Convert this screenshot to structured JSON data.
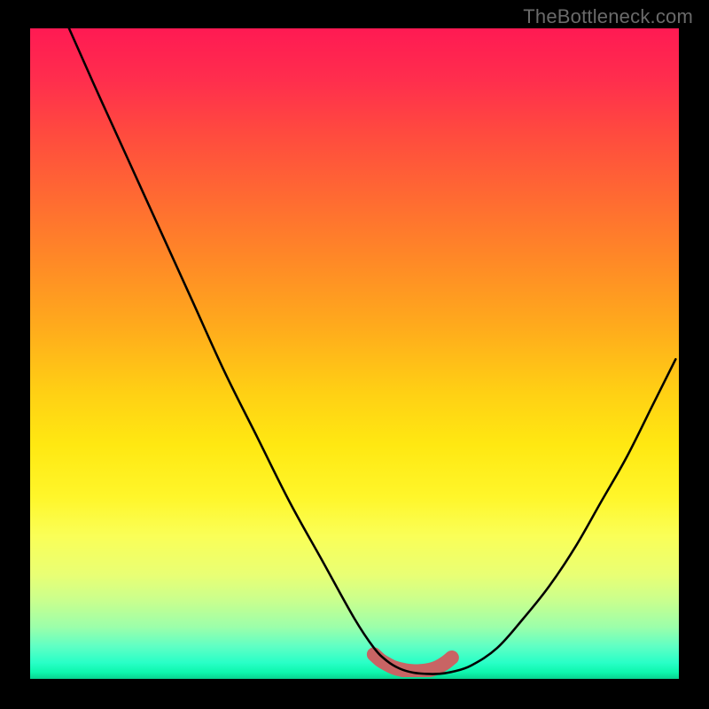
{
  "watermark": "TheBottleneck.com",
  "chart_data": {
    "type": "line",
    "title": "",
    "xlabel": "",
    "ylabel": "",
    "xlim": [
      0,
      100
    ],
    "ylim": [
      0,
      100
    ],
    "grid": false,
    "legend": false,
    "series": [
      {
        "name": "curve",
        "color": "#000000",
        "x": [
          6,
          10,
          15,
          20,
          25,
          30,
          35,
          40,
          45,
          50,
          53,
          55,
          57,
          59,
          61,
          63,
          65,
          68,
          72,
          76,
          80,
          84,
          88,
          92,
          96,
          99.5
        ],
        "y": [
          100,
          91,
          80,
          69,
          58,
          47,
          37,
          27,
          18,
          9,
          4.5,
          2.5,
          1.3,
          0.7,
          0.5,
          0.5,
          0.8,
          1.8,
          4.5,
          9,
          14,
          20,
          27,
          34,
          42,
          49
        ]
      },
      {
        "name": "bottom-band",
        "color": "#c86464",
        "x": [
          53,
          54,
          55,
          56,
          57,
          58,
          59,
          60,
          61,
          62,
          63,
          64,
          65
        ],
        "y": [
          3.5,
          2.6,
          2.0,
          1.5,
          1.2,
          1.0,
          0.9,
          0.9,
          1.0,
          1.2,
          1.6,
          2.2,
          3.0
        ]
      }
    ],
    "background_gradient": {
      "orientation": "vertical",
      "stops": [
        {
          "pos": 0.0,
          "color": "#ff1a53"
        },
        {
          "pos": 0.5,
          "color": "#ffc816"
        },
        {
          "pos": 0.78,
          "color": "#fbff54"
        },
        {
          "pos": 0.92,
          "color": "#9cffaa"
        },
        {
          "pos": 1.0,
          "color": "#09d28f"
        }
      ]
    }
  }
}
